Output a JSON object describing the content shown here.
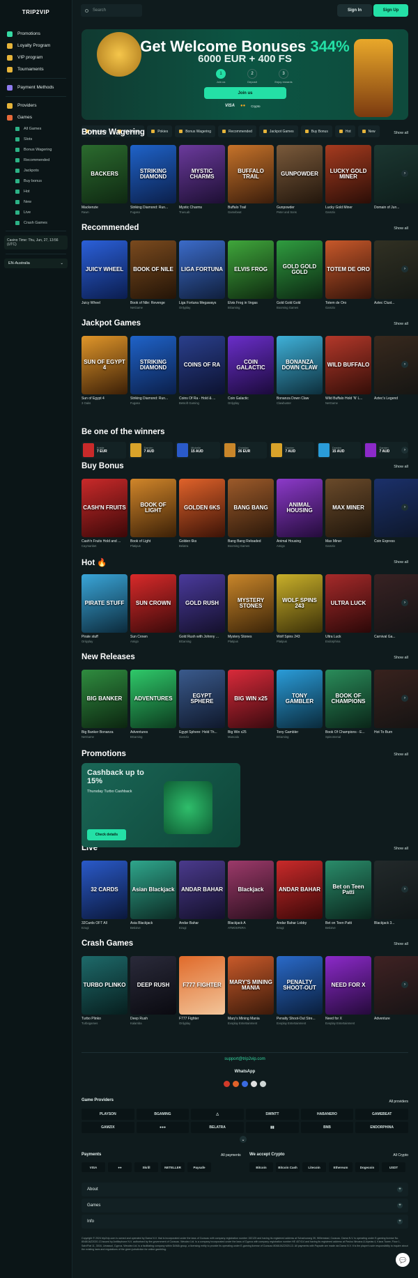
{
  "logo": "TRIP2VIP",
  "sidebar": {
    "items": [
      {
        "label": "Promotions",
        "color": "#35d9a3"
      },
      {
        "label": "Loyalty Program",
        "color": "#e6b43a"
      },
      {
        "label": "VIP program",
        "color": "#e6b43a"
      },
      {
        "label": "Tournaments",
        "color": "#e6b43a"
      },
      {
        "label": "Payment Methods",
        "color": "#8f7cf0"
      },
      {
        "label": "Providers",
        "color": "#e6b43a"
      },
      {
        "label": "Games",
        "color": "#e66a3a"
      }
    ],
    "sub": [
      "All Games",
      "Slots",
      "Bonus Wagering",
      "Recommended",
      "Jackpots",
      "Buy bonus",
      "Hot",
      "New",
      "Live",
      "Crash Games"
    ],
    "time": "Casino Time: Thu, Jun, 27, 13:56 (UTC)",
    "lang": "EN-Australia"
  },
  "topbar": {
    "search_placeholder": "Search",
    "signin": "Sign In",
    "signup": "Sign Up"
  },
  "banner": {
    "title_a": "Get Welcome Bonuses ",
    "title_b": "344%",
    "sub": "6000 EUR + 400 FS",
    "steps": [
      {
        "n": "1",
        "label": "Join us"
      },
      {
        "n": "2",
        "label": "Deposit"
      },
      {
        "n": "3",
        "label": "Enjoy rewards"
      }
    ],
    "join": "Join us",
    "pay": [
      "VISA",
      "●●",
      "Crypto"
    ]
  },
  "filters": [
    "Providers",
    "All Games",
    "Pokies",
    "Bonus Wagering",
    "Recommended",
    "Jackpot Games",
    "Buy Bonus",
    "Hot",
    "New"
  ],
  "show_all": "Show all",
  "sections": [
    {
      "title": "Bonus Wagering",
      "games": [
        {
          "name": "Mackenzie",
          "prov": "Rawn",
          "art": "BACKERS",
          "c1": "#2b6b2e",
          "c2": "#0f2812"
        },
        {
          "name": "Striking Diamond: Run...",
          "prov": "Fugaso",
          "art": "STRIKING DIAMOND",
          "c1": "#1f63c9",
          "c2": "#0b1f4a"
        },
        {
          "name": "Mystic Charms",
          "prov": "TrueLab",
          "art": "MYSTIC CHARMS",
          "c1": "#6b3a9c",
          "c2": "#1d0f33"
        },
        {
          "name": "Buffalo Trail",
          "prov": "Gamebeat",
          "art": "BUFFALO TRAIL",
          "c1": "#c6732a",
          "c2": "#3b1d0b"
        },
        {
          "name": "Gunpowder",
          "prov": "Peter and Sons",
          "art": "GUNPOWDER",
          "c1": "#7a5a3b",
          "c2": "#22160c"
        },
        {
          "name": "Lucky Gold Miner",
          "prov": "Gamzix",
          "art": "LUCKY GOLD MINER",
          "c1": "#a63b1f",
          "c2": "#2b0e07"
        },
        {
          "name": "Domain of Jun...",
          "prov": "",
          "art": "",
          "c1": "#2b5a4a",
          "c2": "#0d2018"
        }
      ]
    },
    {
      "title": "Recommended",
      "games": [
        {
          "name": "Juicy Wheel",
          "prov": "",
          "art": "JUICY WHEEL",
          "c1": "#2b60d9",
          "c2": "#0b1d4e"
        },
        {
          "name": "Book of Nile: Revenge",
          "prov": "NetGame",
          "art": "BOOK OF NILE",
          "c1": "#7a4a1e",
          "c2": "#231407"
        },
        {
          "name": "Liga Fortuna Megaways",
          "prov": "Onlyplay",
          "art": "LIGA FORTUNA",
          "c1": "#3b6bc9",
          "c2": "#101f3c"
        },
        {
          "name": "Elvis Frog in Vegas",
          "prov": "BGaming",
          "art": "ELVIS FROG",
          "c1": "#3fa63b",
          "c2": "#0f2b10"
        },
        {
          "name": "Gold Gold Gold",
          "prov": "Booming Games",
          "art": "GOLD GOLD GOLD",
          "c1": "#2f9c3f",
          "c2": "#0c2712"
        },
        {
          "name": "Totem de Oro",
          "prov": "Gamzix",
          "art": "TOTEM DE ORO",
          "c1": "#c7582a",
          "c2": "#35140a"
        },
        {
          "name": "Aztec Clust...",
          "prov": "",
          "art": "",
          "c1": "#5a4a2a",
          "c2": "#1c160b"
        }
      ]
    },
    {
      "title": "Jackpot Games",
      "games": [
        {
          "name": "Sun of Egypt 4",
          "prov": "3 Oaks",
          "art": "SUN OF EGYPT 4",
          "c1": "#e0962a",
          "c2": "#3b1f07"
        },
        {
          "name": "Striking Diamond: Run...",
          "prov": "Fugaso",
          "art": "STRIKING DIAMOND",
          "c1": "#1f63c9",
          "c2": "#0b1f4a"
        },
        {
          "name": "Coins Of Ra - Hold & ...",
          "prov": "Betsoft Gaming",
          "art": "COINS OF RA",
          "c1": "#2a3f8c",
          "c2": "#0c1230"
        },
        {
          "name": "Coin Galactic",
          "prov": "Onlyplay",
          "art": "COIN GALACTIC",
          "c1": "#6a2ec9",
          "c2": "#1b0a3b"
        },
        {
          "name": "Bonanza Down Claw",
          "prov": "Clawbuster",
          "art": "BONANZA DOWN CLAW",
          "c1": "#3fb1d9",
          "c2": "#0d2e3b"
        },
        {
          "name": "Wild Buffalo Hold 'N' L...",
          "prov": "NetGame",
          "art": "WILD BUFFALO",
          "c1": "#b3382a",
          "c2": "#330e08"
        },
        {
          "name": "Aztec's Legend",
          "prov": "",
          "art": "",
          "c1": "#6a3a1e",
          "c2": "#1e0f07"
        }
      ]
    },
    {
      "title": "Buy Bonus",
      "games": [
        {
          "name": "Cash'n Fruits Hold and ...",
          "prov": "Caymanbet",
          "art": "CASH'N FRUITS",
          "c1": "#c92a2a",
          "c2": "#3b0808"
        },
        {
          "name": "Book of Light",
          "prov": "Platipus",
          "art": "BOOK OF LIGHT",
          "c1": "#d1862a",
          "c2": "#3b2007"
        },
        {
          "name": "Golden 6ks",
          "prov": "Belatra",
          "art": "GOLDEN 6KS",
          "c1": "#e0622a",
          "c2": "#3b1307"
        },
        {
          "name": "Bang Bang Reloaded",
          "prov": "Booming Games",
          "art": "BANG BANG",
          "c1": "#9c5a2a",
          "c2": "#2b180a"
        },
        {
          "name": "Animal Housing",
          "prov": "Amigo",
          "art": "ANIMAL HOUSING",
          "c1": "#8c3ac9",
          "c2": "#240c3b"
        },
        {
          "name": "Max Miner",
          "prov": "Gamzix",
          "art": "MAX MINER",
          "c1": "#6a4a2a",
          "c2": "#1e150b"
        },
        {
          "name": "Coin Express",
          "prov": "",
          "art": "",
          "c1": "#2a4ac9",
          "c2": "#0b133b"
        }
      ]
    },
    {
      "title": "Hot 🔥",
      "games": [
        {
          "name": "Pirate stuff",
          "prov": "Onlyplay",
          "art": "PIRATE STUFF",
          "c1": "#3aa6d9",
          "c2": "#0c2a3b"
        },
        {
          "name": "Sun Crown",
          "prov": "Amigo",
          "art": "SUN CROWN",
          "c1": "#d92a2a",
          "c2": "#3b0a0a"
        },
        {
          "name": "Gold Rush with Johnny ...",
          "prov": "BGaming",
          "art": "GOLD RUSH",
          "c1": "#4a3a9c",
          "c2": "#14102b"
        },
        {
          "name": "Mystery Stones",
          "prov": "Platipus",
          "art": "MYSTERY STONES",
          "c1": "#c9862a",
          "c2": "#3b2408"
        },
        {
          "name": "Wolf Spins 243",
          "prov": "Platipus",
          "art": "WOLF SPINS 243",
          "c1": "#c9b02a",
          "c2": "#3b3008"
        },
        {
          "name": "Ultra Luck",
          "prov": "Endorphina",
          "art": "ULTRA LUCK",
          "c1": "#a62a2a",
          "c2": "#2b0808"
        },
        {
          "name": "Carnival Ga...",
          "prov": "",
          "art": "",
          "c1": "#6a2a2a",
          "c2": "#1e0b0b"
        }
      ]
    },
    {
      "title": "New Releases",
      "games": [
        {
          "name": "Big Banker Bonanza",
          "prov": "NetGame",
          "art": "BIG BANKER",
          "c1": "#2f8c3f",
          "c2": "#0c2510"
        },
        {
          "name": "Adventures",
          "prov": "BGaming",
          "art": "ADVENTURES",
          "c1": "#2fc96a",
          "c2": "#0c3b1e"
        },
        {
          "name": "Egypt Sphere: Hold Th...",
          "prov": "Gamzix",
          "art": "EGYPT SPHERE",
          "c1": "#3a5a8c",
          "c2": "#0f182b"
        },
        {
          "name": "Big Win x25",
          "prov": "Mancala",
          "art": "BIG WIN x25",
          "c1": "#d92a3a",
          "c2": "#3b0a0f"
        },
        {
          "name": "Tony Gambler",
          "prov": "BGaming",
          "art": "TONY GAMBLER",
          "c1": "#2a9cd9",
          "c2": "#0a2a3b"
        },
        {
          "name": "Book Of Champions - E...",
          "prov": "Spinomenal",
          "art": "BOOK OF CHAMPIONS",
          "c1": "#2a8c5a",
          "c2": "#0a2518"
        },
        {
          "name": "Hot To Burn",
          "prov": "",
          "art": "",
          "c1": "#6a2a1e",
          "c2": "#1e0b07"
        }
      ]
    },
    {
      "title": "Live",
      "games": [
        {
          "name": "32Cards OFT All",
          "prov": "Ezugi",
          "art": "32 CARDS",
          "c1": "#2a5ac9",
          "c2": "#0b183b"
        },
        {
          "name": "Asia Blackjack",
          "prov": "Betixive",
          "art": "Asian Blackjack",
          "c1": "#2fa68c",
          "c2": "#0c2b24"
        },
        {
          "name": "Andar Bahar",
          "prov": "Ezugi",
          "art": "ANDAR BAHAR",
          "c1": "#4a3a8c",
          "c2": "#14102b"
        },
        {
          "name": "Blackjack A",
          "prov": "ATMOSFERA",
          "art": "Blackjack",
          "c1": "#9c3a6a",
          "c2": "#2b0f1e"
        },
        {
          "name": "Andar Bahar Lobby",
          "prov": "Ezugi",
          "art": "ANDAR BAHAR",
          "c1": "#c92a2a",
          "c2": "#3b0808"
        },
        {
          "name": "Bet on Teen Patti",
          "prov": "Betixive",
          "art": "Bet on Teen Patti",
          "c1": "#2a8c6a",
          "c2": "#0a251c"
        },
        {
          "name": "Blackjack 3...",
          "prov": "",
          "art": "",
          "c1": "#3a3a3a",
          "c2": "#111111"
        }
      ]
    },
    {
      "title": "Crash Games",
      "games": [
        {
          "name": "Turbo Plinko",
          "prov": "Turbogames",
          "art": "TURBO PLINKO",
          "c1": "#1e6a6a",
          "c2": "#071e1e"
        },
        {
          "name": "Deep Rush",
          "prov": "Kalamba",
          "art": "DEEP RUSH",
          "c1": "#2a2a3a",
          "c2": "#0a0a10"
        },
        {
          "name": "F777 Fighter",
          "prov": "Onlyplay",
          "art": "F777 FIGHTER",
          "c1": "#e06a2a",
          "c2": "#f2c59a"
        },
        {
          "name": "Mary's Mining Mania",
          "prov": "Evoplay Entertainment",
          "art": "MARY'S MINING MANIA",
          "c1": "#c95a2a",
          "c2": "#3b1a0a"
        },
        {
          "name": "Penalty Shoot-Out Stre...",
          "prov": "Evoplay Entertainment",
          "art": "PENALTY SHOOT-OUT",
          "c1": "#2a6ac9",
          "c2": "#0a1e3b"
        },
        {
          "name": "Need for X",
          "prov": "Evoplay Entertainment",
          "art": "NEED FOR X",
          "c1": "#8c2ac9",
          "c2": "#250a3b"
        },
        {
          "name": "Adventure",
          "prov": "",
          "art": "",
          "c1": "#7a2a2a",
          "c2": "#220b0b"
        }
      ]
    }
  ],
  "winners_title": "Be one of the winners",
  "winners": [
    {
      "name": "Kristie",
      "amt": "7 EUR",
      "c": "#c92a2a"
    },
    {
      "name": "Damien",
      "amt": "7 AUD",
      "c": "#d9a32a"
    },
    {
      "name": "Michelle",
      "amt": "15 AUD",
      "c": "#2a5ac9"
    },
    {
      "name": "Christian",
      "amt": "26 EUR",
      "c": "#c9862a"
    },
    {
      "name": "Damien",
      "amt": "7 AUD",
      "c": "#d9a32a"
    },
    {
      "name": "Damien",
      "amt": "15 AUD",
      "c": "#2a9cd9"
    },
    {
      "name": "Damien",
      "amt": "7 AUD",
      "c": "#8c2ac9"
    }
  ],
  "promotions": {
    "title": "Promotions",
    "card_title": "Cashback up to 15%",
    "card_sub": "Thursday Turbo Cashback",
    "btn": "Check details"
  },
  "footer": {
    "support": "support@trip2vip.com",
    "whatsapp": "WhatsApp",
    "providers_title": "Game Providers",
    "all_providers": "All providers",
    "providers": [
      "PLAYSON",
      "BGAMING",
      "△",
      "SWINTT",
      "HABANERO",
      "GAMEBEAT",
      "GAMZIX",
      "●●●",
      "BELATRA",
      "▮▮",
      "BNB",
      "ENDORPHINA"
    ],
    "payments_title": "Payments",
    "all_payments": "All payments",
    "payments": [
      "VISA",
      "●●",
      "Skrill",
      "NETELLER",
      "Paysafe"
    ],
    "crypto_title": "We accept Crypto",
    "all_crypto": "All Crypto",
    "crypto": [
      "Bitcoin",
      "Bitcoin Cash",
      "Litecoin",
      "Ethereum",
      "Dogecoin",
      "USDT"
    ],
    "accordions": [
      "About",
      "Games",
      "Info"
    ],
    "legal": "Copyright © 2024 trip2vip.com is owned and operated by Dama N.V. that is incorporated under the laws of Curacao with company registration number 152125 and having its registered address at Scharlooweg 39, Willemstad, Curacao. Dama N.V. is operating under E-gaming license No. 8048/JAZ2020-13 issued by Antillephone N.V. authorised by the government of Curacao. Weodez Ltd. is a company incorporated under the laws of Cyprus with company registration number HE 407414 and having its registered address at Pavlou Nirvana & Aipeias 4, Kiaos Tower, Floor 1, Salv/Flat 11, 3016, Limassol, Cyprus. Weodez Ltd. is a facilitating company within DAMA group, a licensing entity to provide its operating under E-gaming license of Curacao 8048/JAZ2020-13. All payments with Paysafe are made via Dama N.V. It is the player's sole responsibility to inquire about the existing laws and regulations of the given jurisdiction for online gambling."
  }
}
